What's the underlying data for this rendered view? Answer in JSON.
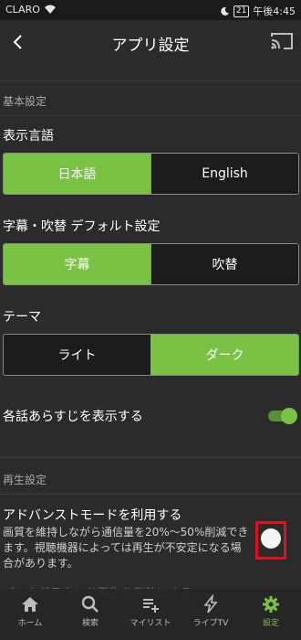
{
  "status_bar": {
    "carrier": "CLARO",
    "battery": "21",
    "time": "午後4:45"
  },
  "header": {
    "title": "アプリ設定",
    "back_icon": "chevron-left-icon",
    "cast_icon": "cast-icon"
  },
  "basic_settings": {
    "section_label": "基本設定",
    "language": {
      "label": "表示言語",
      "options": [
        "日本語",
        "English"
      ],
      "selected": "日本語"
    },
    "subtitle_dub": {
      "label": "字幕・吹替 デフォルト設定",
      "options": [
        "字幕",
        "吹替"
      ],
      "selected": "字幕"
    },
    "theme": {
      "label": "テーマ",
      "options": [
        "ライト",
        "ダーク"
      ],
      "selected": "ダーク"
    },
    "synopsis": {
      "label": "各話あらすじを表示する",
      "on": true
    }
  },
  "playback_settings": {
    "section_label": "再生設定",
    "advanced_mode": {
      "label": "アドバンストモードを利用する",
      "description": "画質を維持しながら通信量を20%〜50%削減できます。視聴機器によっては再生が不安定になる場合があります。",
      "on": false
    },
    "background_play": {
      "label": "バックグラウンド再生を有効にする"
    }
  },
  "bottom_nav": {
    "items": [
      {
        "label": "ホーム",
        "icon": "home-icon"
      },
      {
        "label": "検索",
        "icon": "search-icon"
      },
      {
        "label": "マイリスト",
        "icon": "playlist-add-icon"
      },
      {
        "label": "ライブTV",
        "icon": "live-tv-icon"
      },
      {
        "label": "設定",
        "icon": "gear-icon"
      }
    ],
    "active": "設定"
  },
  "colors": {
    "accent": "#79c244",
    "background": "#2b2b2b",
    "highlight": "#e0101d"
  }
}
